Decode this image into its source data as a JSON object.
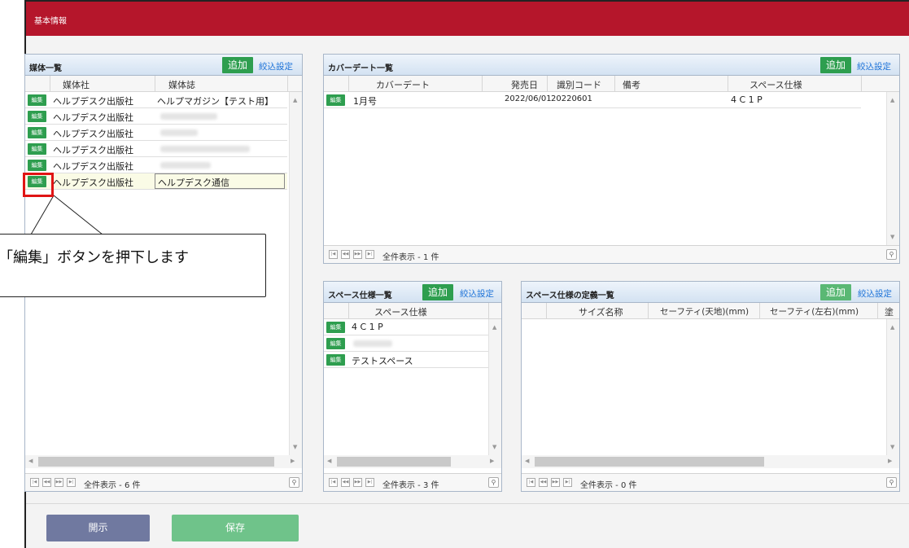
{
  "section_title": "基本情報",
  "media": {
    "title": "媒体一覧",
    "add": "追加",
    "filter": "絞込設定",
    "col1": "媒体社",
    "col2": "媒体誌",
    "rows": [
      {
        "edit": "編集",
        "publisher": "ヘルプデスク出版社",
        "magazine": "ヘルプマガジン【テスト用】"
      },
      {
        "edit": "編集",
        "publisher": "ヘルプデスク出版社",
        "magazine": ""
      },
      {
        "edit": "編集",
        "publisher": "ヘルプデスク出版社",
        "magazine": ""
      },
      {
        "edit": "編集",
        "publisher": "ヘルプデスク出版社",
        "magazine": ""
      },
      {
        "edit": "編集",
        "publisher": "ヘルプデスク出版社",
        "magazine": ""
      },
      {
        "edit": "編集",
        "publisher": "ヘルプデスク出版社",
        "magazine": "ヘルプデスク通信"
      }
    ],
    "footer": "全件表示 - 6 件"
  },
  "cover": {
    "title": "カバーデート一覧",
    "add": "追加",
    "filter": "絞込設定",
    "cols": [
      "カバーデート",
      "発売日",
      "識別コード",
      "備考",
      "スペース仕様"
    ],
    "rows": [
      {
        "edit": "編集",
        "cover_date": "1月号",
        "release": "2022/06/01",
        "code": "20220601",
        "note": "",
        "space": "4 C 1 P"
      }
    ],
    "footer": "全件表示 - 1 件"
  },
  "space": {
    "title": "スペース仕様一覧",
    "add": "追加",
    "filter": "絞込設定",
    "col": "スペース仕様",
    "rows": [
      {
        "edit": "編集",
        "name": "4 C 1 P"
      },
      {
        "edit": "編集",
        "name": ""
      },
      {
        "edit": "編集",
        "name": "テストスペース"
      }
    ],
    "footer": "全件表示 - 3 件"
  },
  "spacedef": {
    "title": "スペース仕様の定義一覧",
    "add": "追加",
    "filter": "絞込設定",
    "cols": [
      "サイズ名称",
      "セーフティ(天地)(mm)",
      "セーフティ(左右)(mm)",
      "塗り"
    ],
    "footer": "全件表示 - 0 件"
  },
  "buttons": {
    "open": "開示",
    "save": "保存"
  },
  "callout": "「編集」ボタンを押下します",
  "colors": {
    "header": "#b5162b",
    "add_button": "#2e9e4f",
    "open_button": "#7079a0",
    "save_button": "#6fc38a",
    "highlight": "#e01414"
  }
}
